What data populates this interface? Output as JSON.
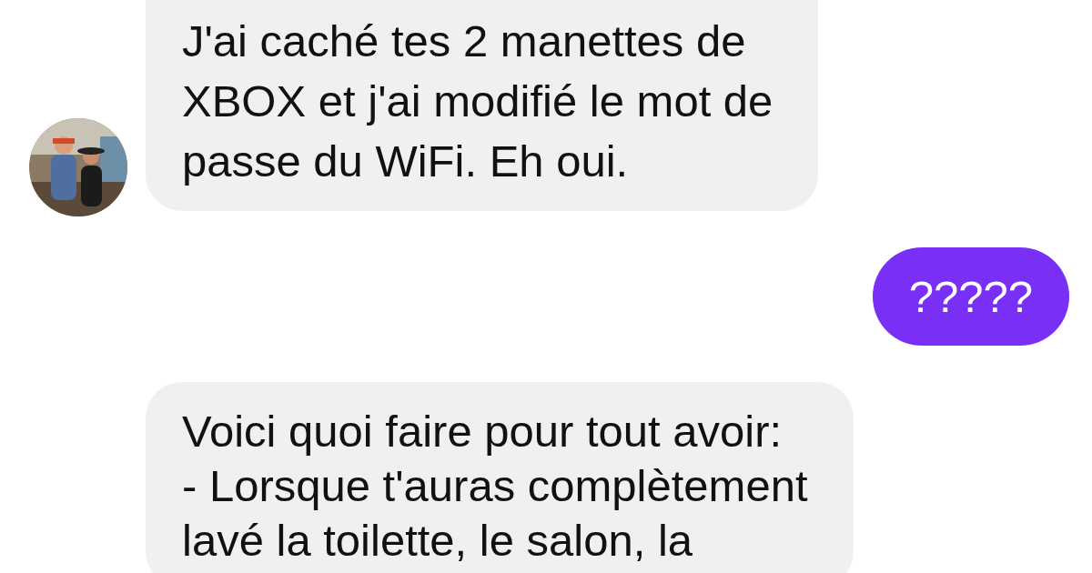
{
  "messages": [
    {
      "kind": "received",
      "avatar": true,
      "text": "J'ai caché tes 2 manettes de\nXBOX et j'ai modifié le mot de\npasse du WiFi. Eh oui."
    },
    {
      "kind": "sent",
      "avatar": false,
      "text": "?????"
    },
    {
      "kind": "received",
      "avatar": false,
      "text": "Voici quoi faire pour tout avoir:\n- Lorsque t'auras complètement\nlavé la toilette, le salon, la"
    }
  ]
}
